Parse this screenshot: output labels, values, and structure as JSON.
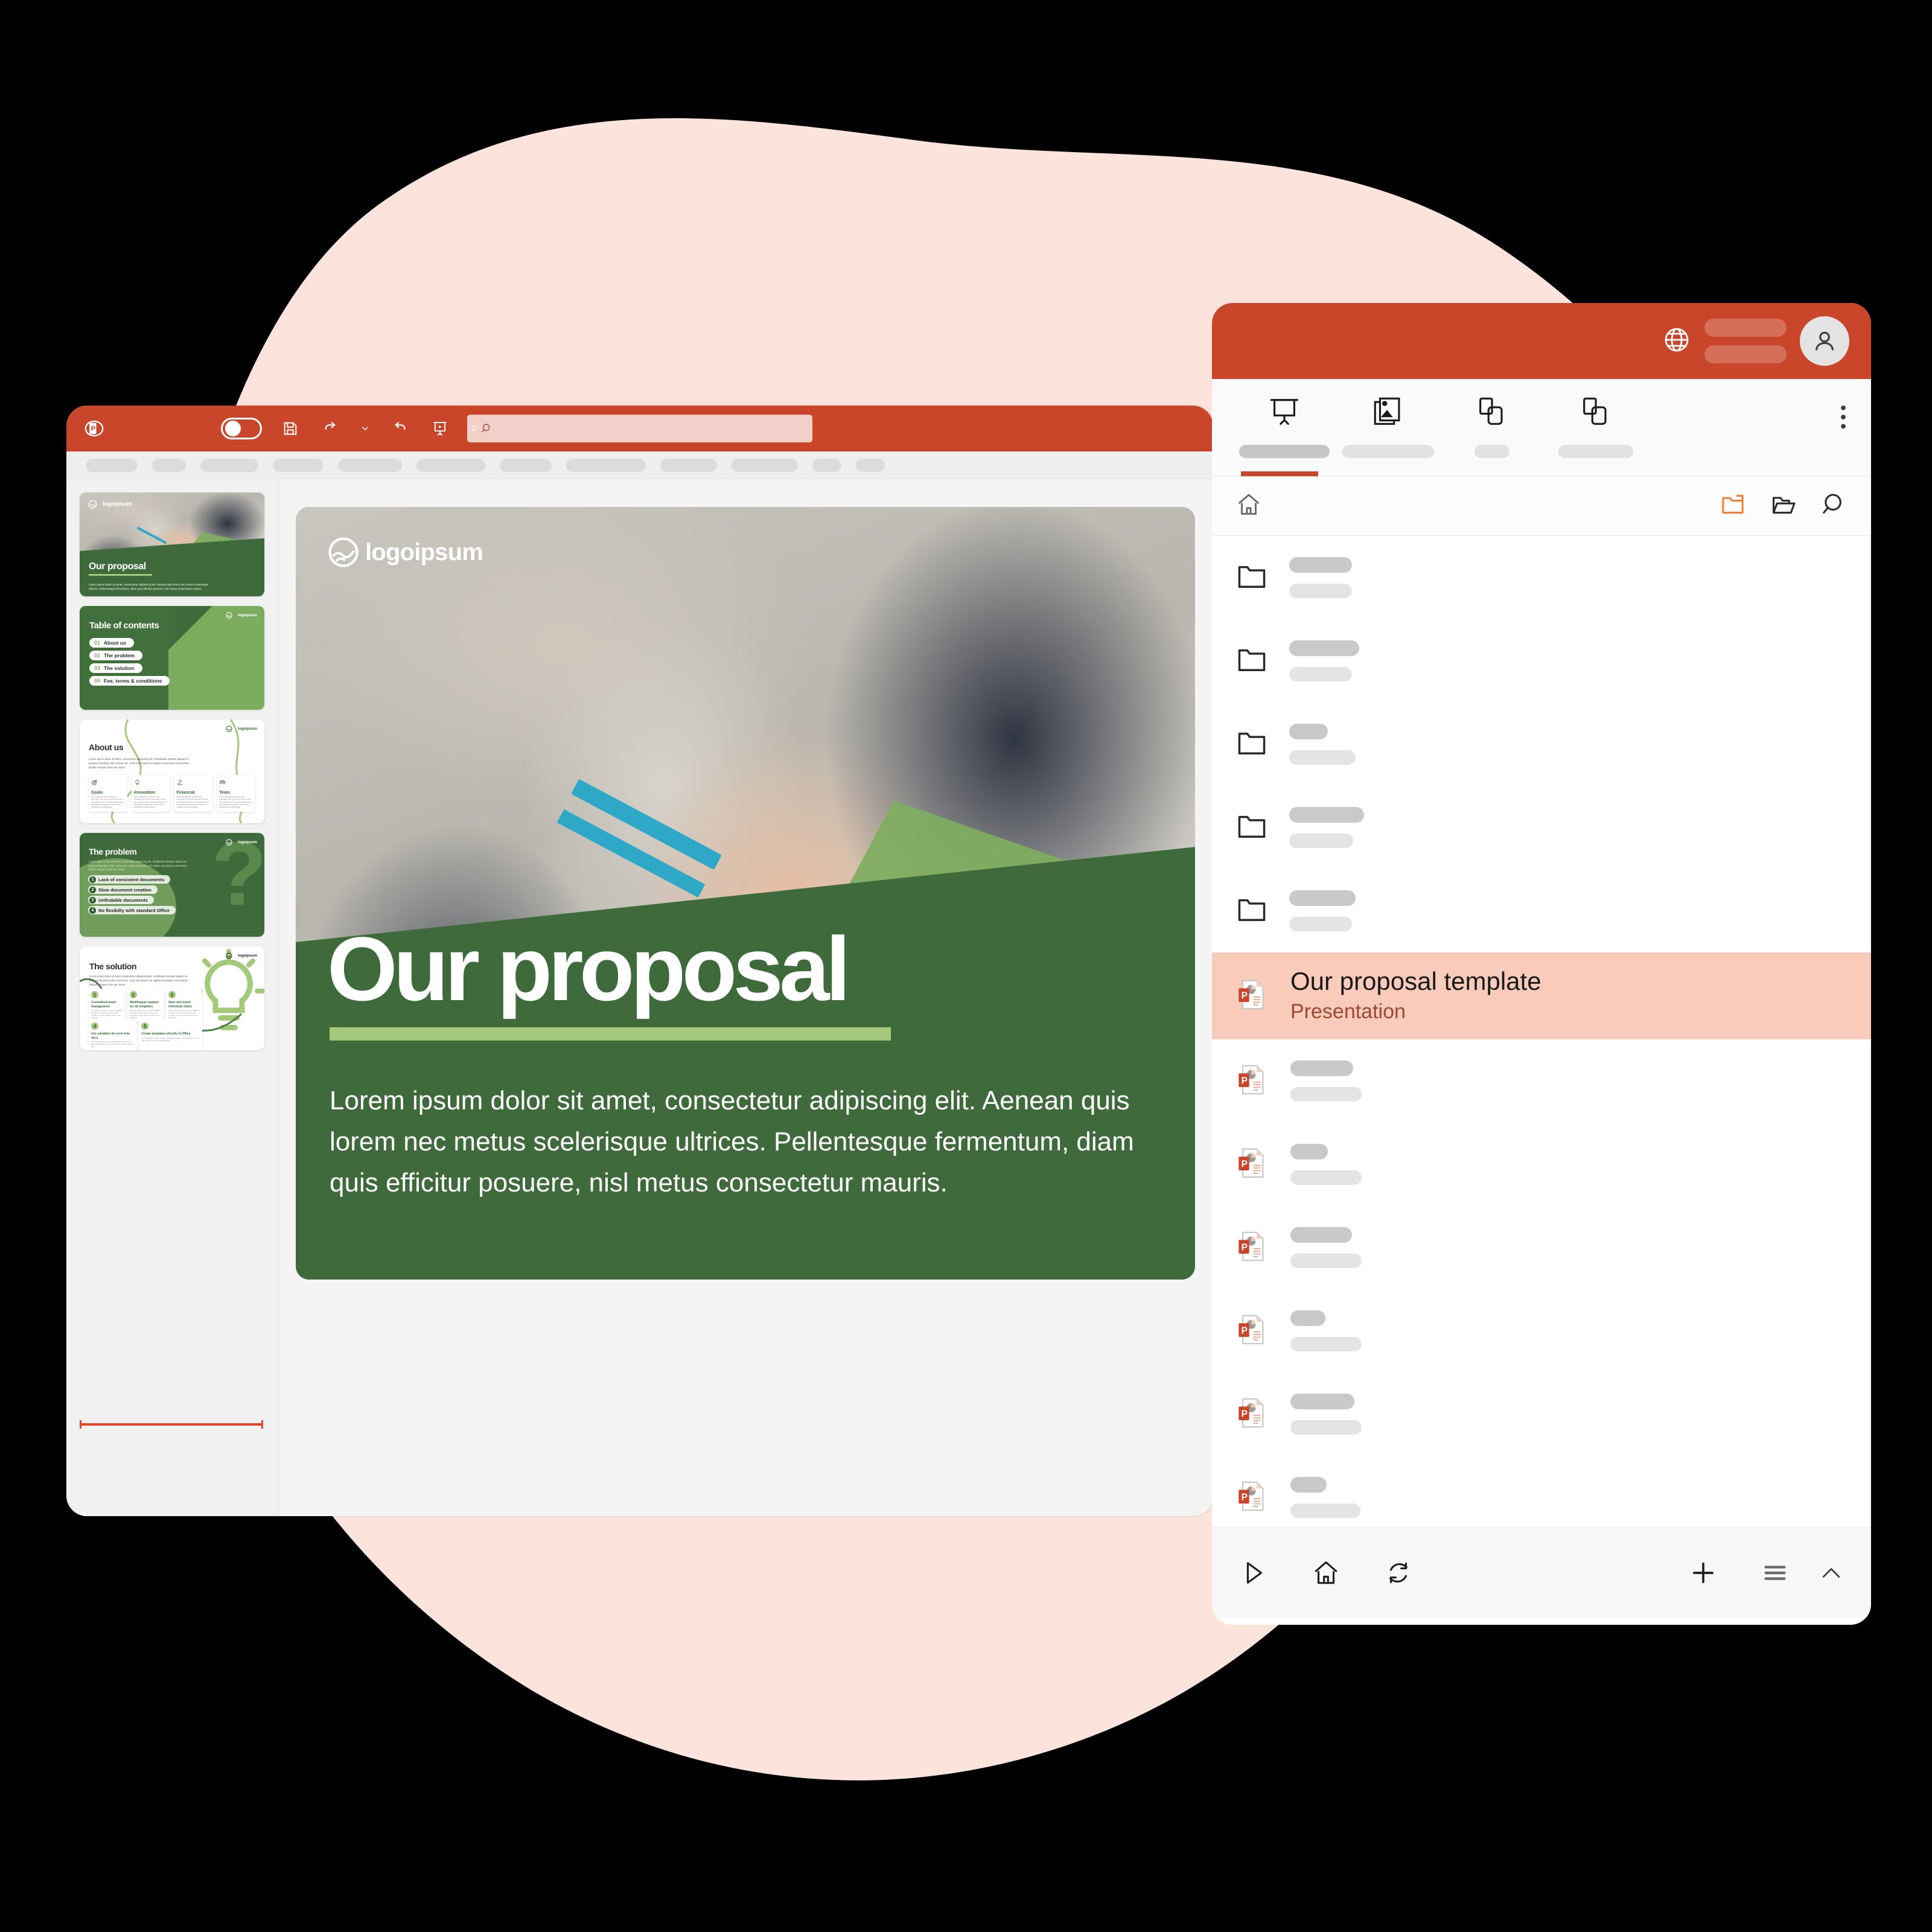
{
  "background": {
    "blob_color": "#FCE4DC",
    "page_color": "#000000"
  },
  "desktop": {
    "titlebar": {
      "app_icon": "powerpoint-icon",
      "toggle": "autosave-toggle",
      "save_icon": "save-icon",
      "undo_icon": "undo-icon",
      "undo_chevron_icon": "chevron-down-icon",
      "redo_icon": "redo-icon",
      "present_icon": "present-icon",
      "more_icon": "chevron-down-icon",
      "accent": "#C9462A"
    },
    "search": {
      "value": "",
      "placeholder": "",
      "icon": "search-icon"
    },
    "ribbon_tabs": [
      {
        "label": "",
        "width": 86
      },
      {
        "label": "",
        "width": 56
      },
      {
        "label": "",
        "width": 96
      },
      {
        "label": "",
        "width": 84
      },
      {
        "label": "",
        "width": 106
      },
      {
        "label": "",
        "width": 114
      },
      {
        "label": "",
        "width": 86
      },
      {
        "label": "",
        "width": 132
      },
      {
        "label": "",
        "width": 94
      },
      {
        "label": "",
        "width": 110
      },
      {
        "label": "",
        "width": 48
      },
      {
        "label": "",
        "width": 48
      }
    ],
    "scrollbar": {
      "name": "thumbnail-scrollbar",
      "color": "#E0462A"
    },
    "slides": [
      {
        "id": "slide-1",
        "type": "cover",
        "logo": "logoipsum",
        "title": "Our proposal",
        "body": "Lorem ipsum dolor sit amet, consectetur adipiscing elit. Aenean quis lorem nec metus scelerisque ultrices. Pellentesque fermentum, diam quis efficitur posuere, nisl metus consectetur mauris.",
        "selected": true
      },
      {
        "id": "slide-2",
        "type": "toc",
        "logo": "logoipsum",
        "title": "Table of contents",
        "items": [
          {
            "number": "01",
            "label": "About us"
          },
          {
            "number": "02",
            "label": "The problem"
          },
          {
            "number": "03",
            "label": "The solution"
          },
          {
            "number": "04",
            "label": "Fee, terms & conditions"
          }
        ]
      },
      {
        "id": "slide-3",
        "type": "about",
        "logo": "logoipsum",
        "title": "About us",
        "body": "Lorem ipsum dolor sit amet, consectetur adipiscing elit. Vestibulum semper aliquet mi, posuere faucibus odio cursus nec. Cras sed mauris vel sapien accumsan consectetur. Nullam semper enim nec lorem .",
        "cards": [
          {
            "icon": "target-icon",
            "title": "Goals",
            "body": "Donec sollicitudin felis sit amet semper consectetur. Proin sit amet varius ante. Ut justo nibh, gravida ut sem at, imperdiet dapibus velit. In hac habitasse platea dictumst. Donec finibus sollicitudin lectus eget vulputate."
          },
          {
            "icon": "lightbulb-icon",
            "title": "Innovation",
            "body": "Donec sollicitudin felis sit amet semper consectetur. Proin sit amet varius ante. Ut justo nibh, gravida ut sem at, imperdiet dapibus velit. In hac habitasse platea dictumst. Donec finibus sollicitudin lectus eget vulputate."
          },
          {
            "icon": "hand-coin-icon",
            "title": "Financial",
            "body": "Donec sollicitudin felis sit amet semper consectetur. Proin sit amet varius ante. Ut justo nibh, gravida ut sem at, imperdiet dapibus velit. In hac habitasse platea dictumst. Donec finibus sollicitudin lectus eget vulputate."
          },
          {
            "icon": "team-icon",
            "title": "Team",
            "body": "Donec sollicitudin felis sit amet semper consectetur. Proin sit amet varius ante. Ut justo nibh, gravida ut sem at, imperdiet dapibus velit. In hac habitasse platea dictumst. Donec finibus sollicitudin lectus eget vulputate."
          }
        ]
      },
      {
        "id": "slide-4",
        "type": "problem",
        "logo": "logoipsum",
        "title": "The problem",
        "body": "Lorem ipsum dolor sit amet, consectetur adipiscing elit. Vestibulum semper aliquet mi, posuere faucibus odio cursus nec. Cras sed mauris vel sapien accumsan consectetur. Nullam semper enim nec lorem .",
        "items": [
          {
            "number": "1",
            "label": "Lack of consistent documents"
          },
          {
            "number": "2",
            "label": "Slow document creation"
          },
          {
            "number": "3",
            "label": "Unfindable documents"
          },
          {
            "number": "4",
            "label": "No flexibilty with standard Office"
          }
        ]
      },
      {
        "id": "slide-5",
        "type": "solution",
        "logo": "logoipsum",
        "title": "The solution",
        "body": "Lorem ipsum dolor sit amet, consectetur adipiscing elit. Vestibulum semper aliquet mi, posuere faucibus odio cursus nec. Cras sed mauris vel sapien accumsan consectetur. Nullam semper enim nec lorem .",
        "cards": [
          {
            "number": "1",
            "title": "Centralized asset management",
            "body": "Lorem ipsum dolor sit amet, consectetur adipiscing elit. Nullam in elit velit sapien. Donec ac felis venenatis nec molliset, gravida ex quam. Ut nec blandit justo."
          },
          {
            "number": "2",
            "title": "Multilingual support for all templates",
            "body": "Lorem ipsum dolor sit amet, consectetur adipiscing elit. Nullam in elit velit sapien. Donec ac felis venenatis nec molliset, gravida ex quam. Ut nec blandit justo."
          },
          {
            "number": "3",
            "title": "Save and insert individual slides",
            "body": "Lorem ipsum dolor sit amet, consectetur adipiscing elit. Nullam in elit velit sapien. Donec ac felis venenatis nec molliset, gravida ex quam. Ut nec blandit justo."
          },
          {
            "number": "4",
            "title": "Use variables for error-free docs",
            "body": "Lorem ipsum dolor sit amet, consectetur adipiscing elit. Nullam in mollis velit sapien. Donec ex felis, venenatis nec mollis et, gravida eu quam."
          },
          {
            "number": "5",
            "title": "Create templates directly in Office",
            "body": "Lorem ipsum dolor sit amet, consectetur adipiscing elit. Nullam in mollis velit sapien. Donec ex felis, venenatis nec mollis et, gravida eu quam."
          }
        ]
      }
    ],
    "main_slide": {
      "logo": "logoipsum",
      "title": "Our proposal",
      "body": "Lorem ipsum dolor sit amet, consectetur adipiscing elit. Aenean quis lorem nec metus scelerisque ultrices. Pellentesque fermentum, diam quis efficitur posuere, nisl metus consectetur mauris."
    }
  },
  "mobile": {
    "header": {
      "globe_icon": "globe-icon",
      "avatar_icon": "user-avatar-icon",
      "accent": "#C9462A"
    },
    "tabs": [
      {
        "icon": "presentation-screen-icon",
        "label": "",
        "label_width": 150,
        "active": true
      },
      {
        "icon": "image-slide-icon",
        "label": "",
        "label_width": 152,
        "active": false
      },
      {
        "icon": "copy-slide-icon",
        "label": "",
        "label_width": 58,
        "active": false
      },
      {
        "icon": "duplicate-slide-icon",
        "label": "",
        "label_width": 124,
        "active": false
      }
    ],
    "kebab_icon": "more-vertical-icon",
    "subbar": {
      "home_icon": "home-icon",
      "new_folder_icon": "new-folder-icon",
      "open_folder_icon": "open-folder-icon",
      "search_icon": "search-icon"
    },
    "list": [
      {
        "type": "folder",
        "icon": "folder-icon",
        "top_width": 104,
        "bot_width": 104,
        "selected": false
      },
      {
        "type": "folder",
        "icon": "folder-icon",
        "top_width": 116,
        "bot_width": 104,
        "selected": false
      },
      {
        "type": "folder",
        "icon": "folder-icon",
        "top_width": 64,
        "bot_width": 110,
        "selected": false
      },
      {
        "type": "folder",
        "icon": "folder-icon",
        "top_width": 124,
        "bot_width": 106,
        "selected": false
      },
      {
        "type": "folder",
        "icon": "folder-icon",
        "top_width": 110,
        "bot_width": 104,
        "selected": false
      },
      {
        "type": "file",
        "icon": "powerpoint-file-icon",
        "title": "Our proposal template",
        "subtitle": "Presentation",
        "selected": true
      },
      {
        "type": "file",
        "icon": "powerpoint-file-icon",
        "top_width": 104,
        "bot_width": 118,
        "selected": false
      },
      {
        "type": "file",
        "icon": "powerpoint-file-icon",
        "top_width": 62,
        "bot_width": 118,
        "selected": false
      },
      {
        "type": "file",
        "icon": "powerpoint-file-icon",
        "top_width": 102,
        "bot_width": 118,
        "selected": false
      },
      {
        "type": "file",
        "icon": "powerpoint-file-icon",
        "top_width": 58,
        "bot_width": 118,
        "selected": false
      },
      {
        "type": "file",
        "icon": "powerpoint-file-icon",
        "top_width": 106,
        "bot_width": 118,
        "selected": false
      },
      {
        "type": "file",
        "icon": "powerpoint-file-icon",
        "top_width": 60,
        "bot_width": 116,
        "selected": false
      }
    ],
    "bottombar": {
      "play_icon": "play-icon",
      "home_icon": "home-icon",
      "refresh_icon": "refresh-icon",
      "add_icon": "plus-icon",
      "menu_icon": "hamburger-menu-icon",
      "collapse_icon": "chevron-up-icon"
    }
  }
}
